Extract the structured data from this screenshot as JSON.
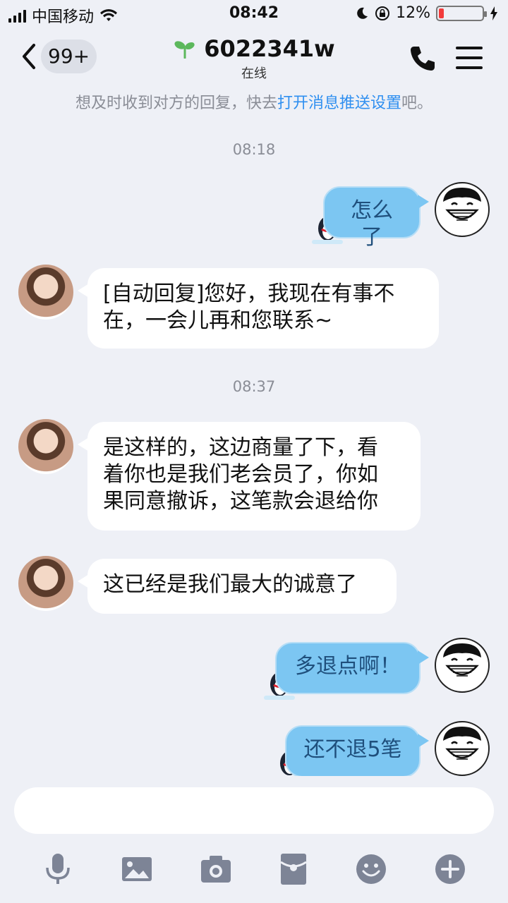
{
  "status_bar": {
    "carrier": "中国移动",
    "time": "08:42",
    "battery_text": "12%",
    "battery_level": 0.12,
    "battery_color": "#f23b3b"
  },
  "nav": {
    "unread_badge": "99+",
    "contact_name": "6022341w",
    "status": "在线"
  },
  "notice": {
    "prefix": "想及时收到对方的回复，快去",
    "link": "打开消息推送设置",
    "suffix": "吧。"
  },
  "messages": [
    {
      "type": "timestamp",
      "text": "08:18"
    },
    {
      "type": "outgoing",
      "text": "怎么了"
    },
    {
      "type": "incoming",
      "lines": [
        "[自动回复]您好，我现在有事不",
        "在，一会儿再和您联系~"
      ]
    },
    {
      "type": "timestamp",
      "text": "08:37"
    },
    {
      "type": "incoming",
      "lines": [
        "是这样的，这边商量了下，看",
        "着你也是我们老会员了，你如",
        "果同意撤诉，这笔款会退给你"
      ]
    },
    {
      "type": "incoming",
      "lines": [
        "这已经是我们最大的诚意了"
      ]
    },
    {
      "type": "outgoing",
      "text": "多退点啊！"
    },
    {
      "type": "outgoing",
      "text": "还不退5笔"
    }
  ],
  "input": {
    "placeholder": ""
  },
  "toolbar": [
    "microphone-icon",
    "image-icon",
    "camera-icon",
    "red-packet-icon",
    "emoji-icon",
    "plus-icon"
  ],
  "colors": {
    "background": "#eef0f6",
    "outgoing_bubble": "#7cc6f2",
    "link": "#2f8ff0",
    "toolbar_icon": "#7d8496"
  }
}
